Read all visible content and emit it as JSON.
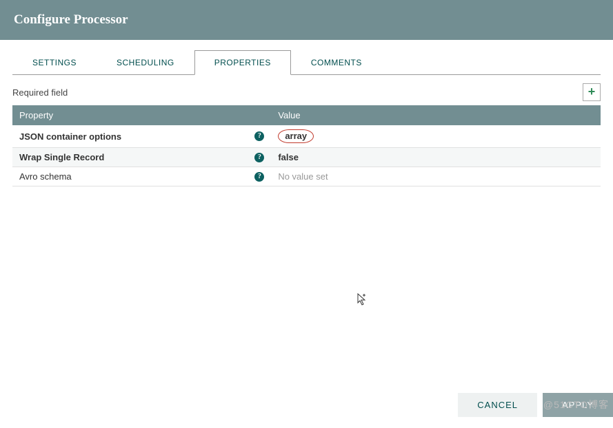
{
  "header": {
    "title": "Configure Processor"
  },
  "tabs": {
    "items": [
      {
        "label": "SETTINGS"
      },
      {
        "label": "SCHEDULING"
      },
      {
        "label": "PROPERTIES"
      },
      {
        "label": "COMMENTS"
      }
    ],
    "active_index": 2
  },
  "properties": {
    "required_label": "Required field",
    "columns": {
      "property": "Property",
      "value": "Value"
    },
    "rows": [
      {
        "name": "JSON container options",
        "name_bold": true,
        "value": "array",
        "value_bold": true,
        "circled": true,
        "placeholder": false
      },
      {
        "name": "Wrap Single Record",
        "name_bold": true,
        "value": "false",
        "value_bold": true,
        "circled": false,
        "placeholder": false
      },
      {
        "name": "Avro schema",
        "name_bold": false,
        "value": "No value set",
        "value_bold": false,
        "circled": false,
        "placeholder": true
      }
    ]
  },
  "footer": {
    "cancel": "CANCEL",
    "apply": "APPLY"
  },
  "watermark": "@51CTO博客",
  "icons": {
    "help_glyph": "?",
    "plus_glyph": "+"
  }
}
